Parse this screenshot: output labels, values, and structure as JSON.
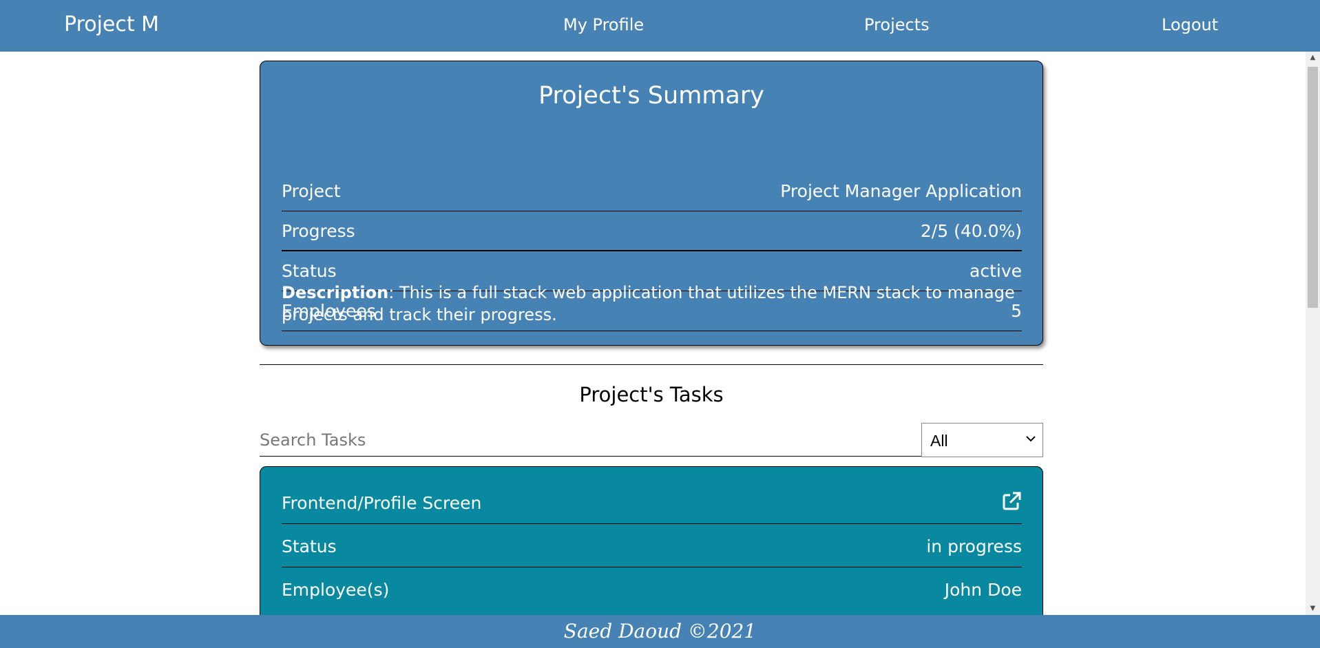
{
  "navbar": {
    "brand": "Project M",
    "links": [
      "My Profile",
      "Projects",
      "Logout"
    ]
  },
  "summary": {
    "title": "Project's Summary",
    "rows": [
      {
        "label": "Project",
        "value": "Project Manager Application"
      },
      {
        "label": "Progress",
        "value": "2/5 (40.0%)"
      },
      {
        "label": "Status",
        "value": "active"
      },
      {
        "label": "Employees",
        "value": "5"
      }
    ],
    "description_label": "Description",
    "description_text": ": This is a full stack web application that utilizes the MERN stack to manage projects and track their progress."
  },
  "tasks": {
    "title": "Project's Tasks",
    "search_placeholder": "Search Tasks",
    "filter_selected": "All",
    "items": [
      {
        "name": "Frontend/Profile Screen",
        "status_label": "Status",
        "status_value": "in progress",
        "employees_label": "Employee(s)",
        "employees_value": "John Doe"
      }
    ]
  },
  "footer": {
    "text": "Saed Daoud ©2021"
  },
  "colors": {
    "navbar": "#4682b4",
    "summary_card": "#4682b4",
    "task_card": "#0889a0"
  },
  "icons": [
    "external-link-icon",
    "chevron-down-icon"
  ]
}
